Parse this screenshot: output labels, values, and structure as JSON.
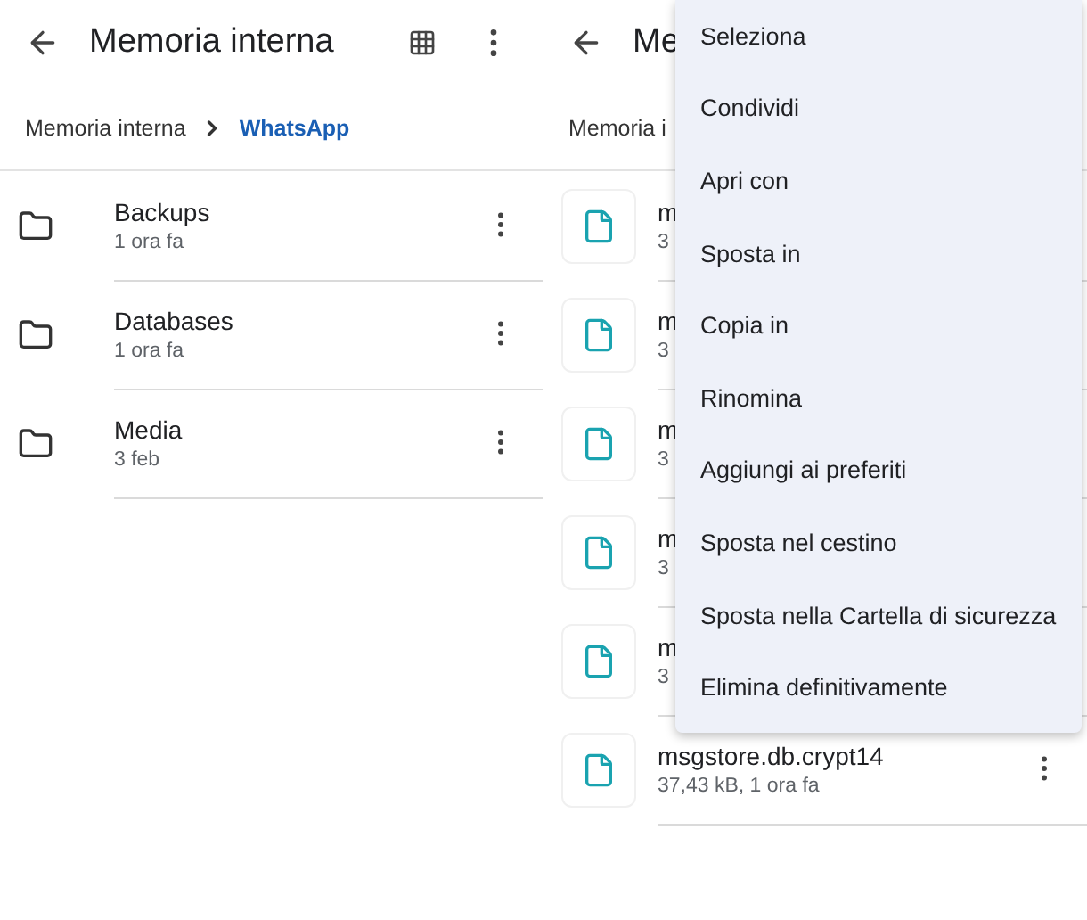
{
  "left_panel": {
    "title": "Memoria interna",
    "breadcrumb": [
      {
        "label": "Memoria interna",
        "selected": false
      },
      {
        "label": "WhatsApp",
        "selected": true
      }
    ],
    "folders": [
      {
        "name": "Backups",
        "meta": "1 ora fa"
      },
      {
        "name": "Databases",
        "meta": "1 ora fa"
      },
      {
        "name": "Media",
        "meta": "3 feb"
      }
    ]
  },
  "right_panel": {
    "title": "Me",
    "breadcrumb": "Memoria i",
    "files": [
      {
        "name": "m",
        "meta": "3"
      },
      {
        "name": "m",
        "meta": "3"
      },
      {
        "name": "m",
        "meta": "3"
      },
      {
        "name": "m",
        "meta": "3"
      },
      {
        "name": "m",
        "meta": "3"
      },
      {
        "name": "msgstore.db.crypt14",
        "meta": "37,43 kB, 1 ora fa"
      }
    ]
  },
  "context_menu": {
    "items": [
      "Seleziona",
      "Condividi",
      "Apri con",
      "Sposta in",
      "Copia in",
      "Rinomina",
      "Aggiungi ai preferiti",
      "Sposta nel cestino",
      "Sposta nella Cartella di sicurezza",
      "Elimina definitivamente"
    ]
  }
}
